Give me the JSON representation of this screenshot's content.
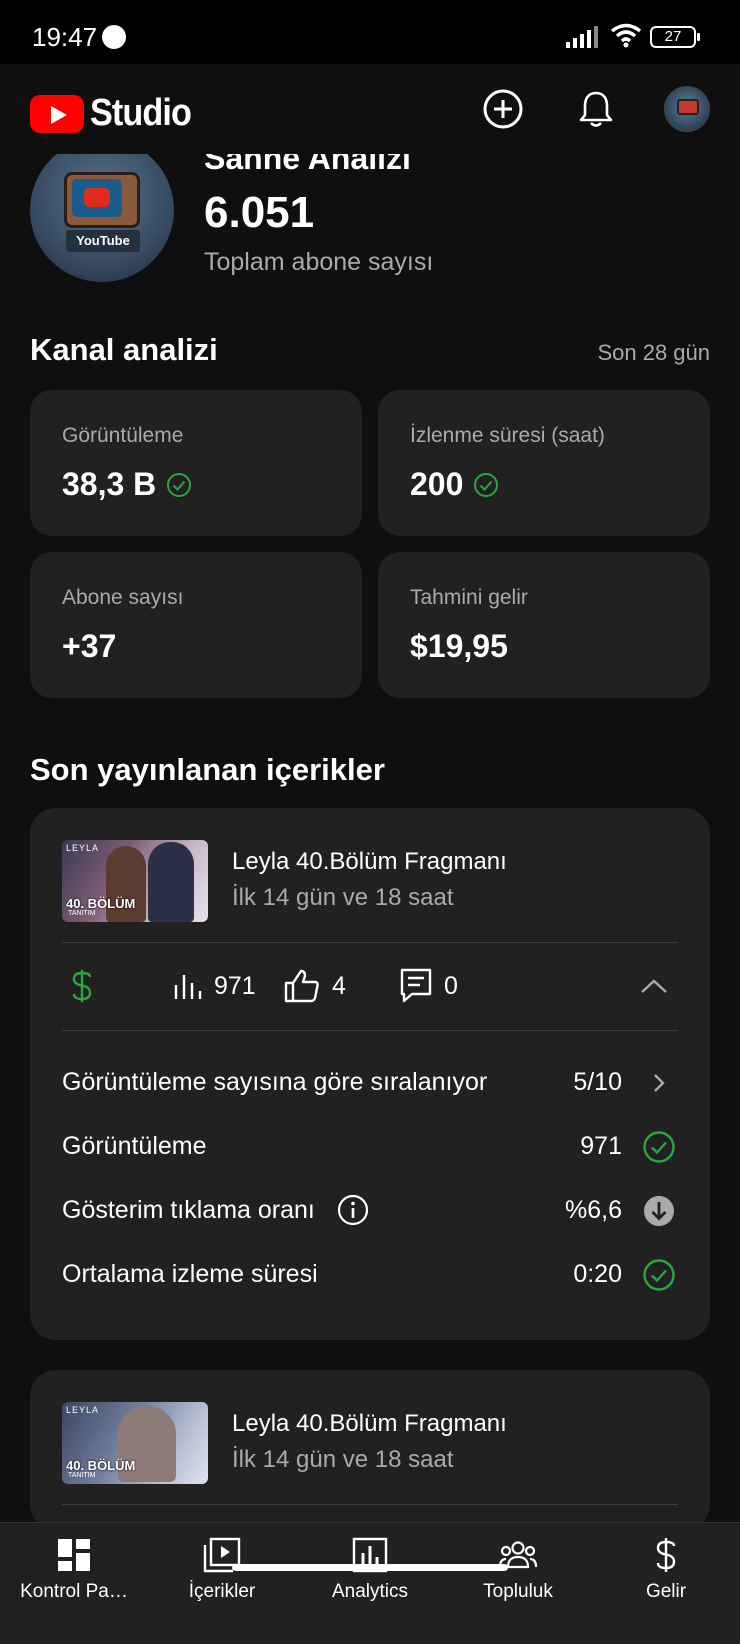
{
  "status_bar": {
    "time": "19:47",
    "battery": "27"
  },
  "header": {
    "logo_text": "Studio",
    "create_icon": "plus-circle-icon",
    "notifications_icon": "bell-icon"
  },
  "channel": {
    "name": "Sahne Analizi",
    "subscriber_count": "6.051",
    "subscriber_label": "Toplam abone sayısı",
    "avatar_text": "YouTube"
  },
  "analytics": {
    "title": "Kanal analizi",
    "period": "Son 28 gün",
    "cards": [
      {
        "label": "Görüntüleme",
        "value": "38,3 B",
        "check": true
      },
      {
        "label": "İzlenme süresi (saat)",
        "value": "200",
        "check": true
      },
      {
        "label": "Abone sayısı",
        "value": "+37",
        "check": false
      },
      {
        "label": "Tahmini gelir",
        "value": "$19,95",
        "check": false
      }
    ]
  },
  "recent": {
    "title": "Son yayınlanan içerikler",
    "items": [
      {
        "title": "Leyla 40.Bölüm Fragmanı",
        "subtitle": "İlk 14 gün ve 18 saat",
        "thumb_top": "LEYLA",
        "thumb_badge": "40. BÖLÜM",
        "thumb_sub": "TANITIM",
        "views": "971",
        "likes": "4",
        "comments": "0",
        "metrics": [
          {
            "label": "Görüntüleme sayısına göre sıralanıyor",
            "value": "5/10",
            "icon": "chevron-right-icon"
          },
          {
            "label": "Görüntüleme",
            "value": "971",
            "icon": "check-circle-icon"
          },
          {
            "label": "Gösterim tıklama oranı",
            "value": "%6,6",
            "icon": "arrow-down-circle-icon"
          },
          {
            "label": "Ortalama izleme süresi",
            "value": "0:20",
            "icon": "check-circle-icon"
          }
        ]
      },
      {
        "title": "Leyla 40.Bölüm Fragmanı",
        "subtitle": "İlk 14 gün ve 18 saat",
        "thumb_top": "LEYLA",
        "thumb_badge": "40. BÖLÜM",
        "thumb_sub": "TANITIM"
      }
    ]
  },
  "bottom_nav": [
    {
      "label": "Kontrol Pa…",
      "icon": "dashboard-icon"
    },
    {
      "label": "İçerikler",
      "icon": "content-icon"
    },
    {
      "label": "Analytics",
      "icon": "analytics-icon"
    },
    {
      "label": "Topluluk",
      "icon": "community-icon"
    },
    {
      "label": "Gelir",
      "icon": "dollar-icon"
    }
  ],
  "colors": {
    "background": "#0f0f0f",
    "card": "#212121",
    "accent_green": "#2ba640",
    "brand_red": "#ff0000"
  }
}
